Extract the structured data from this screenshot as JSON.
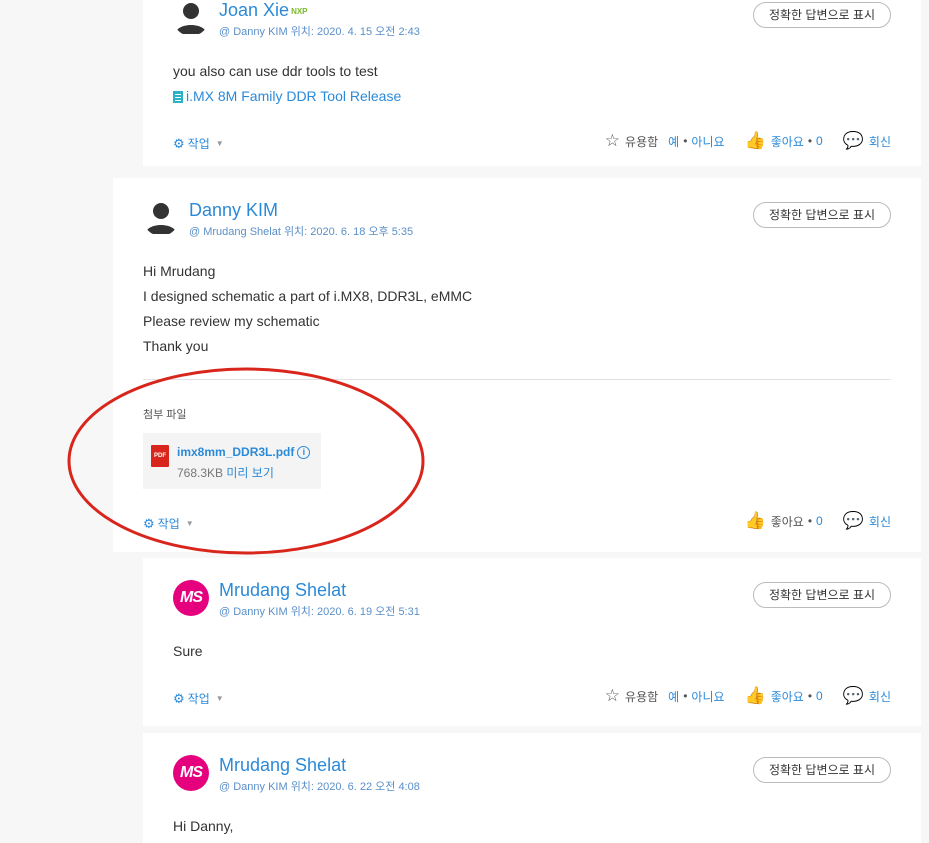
{
  "common": {
    "accept_label": "정확한 답변으로 표시",
    "work_label": "작업",
    "helpful_label": "유용함",
    "yes_label": "예",
    "no_label": "아니요",
    "like_label": "좋아요",
    "reply_label": "회신",
    "dot": "•"
  },
  "posts": [
    {
      "author": "Joan Xie",
      "badge": "NXP",
      "meta": "@ Danny KIM 위치: 2020. 4. 15 오전 2:43",
      "body": [
        "you also can use ddr tools to test"
      ],
      "link": "i.MX 8M Family DDR Tool Release",
      "likes": "0"
    },
    {
      "author": "Danny KIM",
      "meta": "@ Mrudang Shelat 위치: 2020. 6. 18 오후 5:35",
      "body": [
        "Hi Mrudang",
        "I designed schematic a part of i.MX8, DDR3L, eMMC",
        "Please review my schematic",
        "Thank you"
      ],
      "attachments_title": "첨부 파일",
      "file": {
        "name": "imx8mm_DDR3L.pdf",
        "size": "768.3KB",
        "preview": "미리 보기",
        "icon_text": "PDF"
      },
      "likes": "0"
    },
    {
      "author": "Mrudang Shelat",
      "avatar_text": "MS",
      "meta": "@ Danny KIM 위치: 2020. 6. 19 오전 5:31",
      "body": [
        "Sure"
      ],
      "likes": "0"
    },
    {
      "author": "Mrudang Shelat",
      "avatar_text": "MS",
      "meta": "@ Danny KIM 위치: 2020. 6. 22 오전 4:08",
      "body": [
        "Hi Danny,"
      ]
    }
  ],
  "colors": {
    "accent": "#2b8ad8",
    "avatar_ms": "#e5007e",
    "annotation": "#d9261c",
    "pdf": "#d9261c"
  },
  "icons": [
    "user-silhouette-icon",
    "gear-icon",
    "star-icon",
    "thumbs-up-icon",
    "speech-bubble-icon",
    "pdf-icon",
    "info-icon",
    "document-icon"
  ]
}
